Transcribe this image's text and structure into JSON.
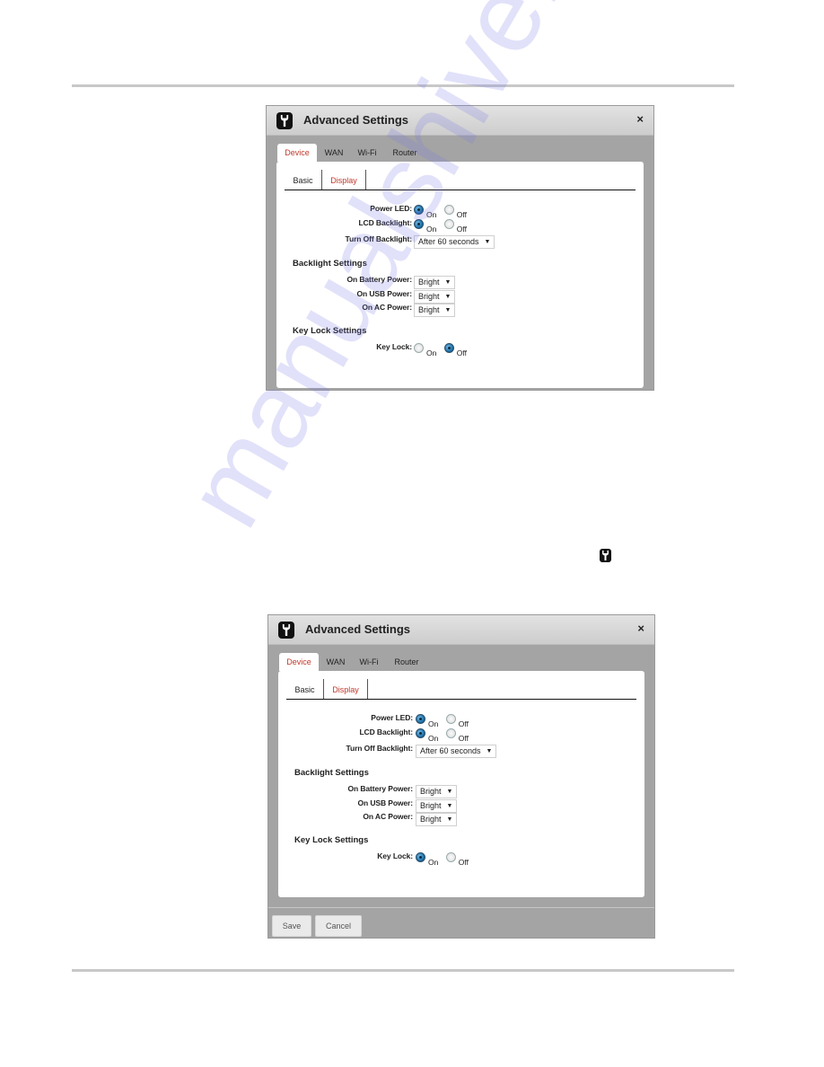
{
  "watermark": "manualshive.com",
  "screens": [
    {
      "title": "Advanced Settings",
      "close": "×",
      "tabs": [
        "Device",
        "WAN",
        "Wi-Fi",
        "Router"
      ],
      "active_tab": "Device",
      "subtabs": [
        "Basic",
        "Display"
      ],
      "active_subtab": "Display",
      "fields": {
        "power_led": {
          "label": "Power LED:",
          "options": [
            "On",
            "Off"
          ],
          "selected": "On"
        },
        "lcd_backlight": {
          "label": "LCD Backlight:",
          "options": [
            "On",
            "Off"
          ],
          "selected": "On"
        },
        "turn_off_backlight": {
          "label": "Turn Off Backlight:",
          "value": "After 60 seconds"
        }
      },
      "backlight_section": "Backlight Settings",
      "backlight": {
        "battery": {
          "label": "On Battery Power:",
          "value": "Bright"
        },
        "usb": {
          "label": "On USB Power:",
          "value": "Bright"
        },
        "ac": {
          "label": "On AC Power:",
          "value": "Bright"
        }
      },
      "keylock_section": "Key Lock Settings",
      "key_lock": {
        "label": "Key Lock:",
        "options": [
          "On",
          "Off"
        ],
        "selected": "Off"
      }
    },
    {
      "title": "Advanced Settings",
      "close": "×",
      "tabs": [
        "Device",
        "WAN",
        "Wi-Fi",
        "Router"
      ],
      "active_tab": "Device",
      "subtabs": [
        "Basic",
        "Display"
      ],
      "active_subtab": "Display",
      "fields": {
        "power_led": {
          "label": "Power LED:",
          "options": [
            "On",
            "Off"
          ],
          "selected": "On"
        },
        "lcd_backlight": {
          "label": "LCD Backlight:",
          "options": [
            "On",
            "Off"
          ],
          "selected": "On"
        },
        "turn_off_backlight": {
          "label": "Turn Off Backlight:",
          "value": "After 60 seconds"
        }
      },
      "backlight_section": "Backlight Settings",
      "backlight": {
        "battery": {
          "label": "On Battery Power:",
          "value": "Bright"
        },
        "usb": {
          "label": "On USB Power:",
          "value": "Bright"
        },
        "ac": {
          "label": "On AC Power:",
          "value": "Bright"
        }
      },
      "keylock_section": "Key Lock Settings",
      "key_lock": {
        "label": "Key Lock:",
        "options": [
          "On",
          "Off"
        ],
        "selected": "On"
      },
      "buttons": {
        "save": "Save",
        "cancel": "Cancel"
      }
    }
  ],
  "colors": {
    "accent_red": "#c0392b",
    "window_gray": "#a4a4a4",
    "radio_blue": "#1b6fa8"
  }
}
